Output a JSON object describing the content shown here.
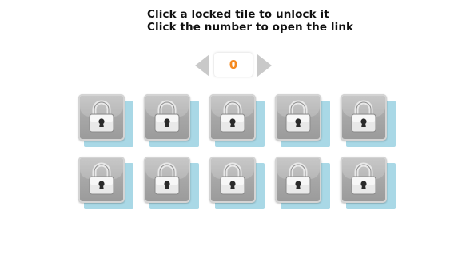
{
  "instructions": {
    "line1": "Click a locked tile to unlock it",
    "line2": "Click the number to open the link"
  },
  "pager": {
    "current": "0",
    "prev_icon": "arrow-left-icon",
    "next_icon": "arrow-right-icon"
  },
  "tiles": {
    "rows": 2,
    "columns": 5,
    "state": "locked",
    "icon": "lock-icon",
    "colors": {
      "tile_face": "#a7a7a7",
      "tile_shadow": "#a9d8e6",
      "page_number": "#f5891f"
    }
  }
}
